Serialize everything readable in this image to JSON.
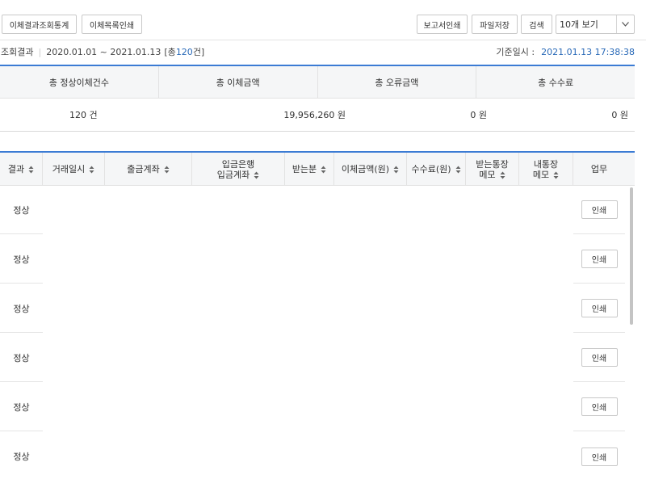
{
  "toolbar": {
    "transfer_stats_label": "이체결과조회통계",
    "list_print_label": "이체목록인쇄",
    "report_print_label": "보고서인쇄",
    "file_save_label": "파일저장",
    "search_label": "검색",
    "page_size_value": "10개 보기"
  },
  "info": {
    "result_label": "조회결과",
    "date_range": "2020.01.01 ~ 2021.01.13",
    "total_prefix": "[총",
    "total_count": "120",
    "total_suffix": "건]",
    "base_label": "기준일시 :",
    "base_datetime": "2021.01.13 17:38:38"
  },
  "summary": {
    "headers": [
      "총 정상이체건수",
      "총 이체금액",
      "총 오류금액",
      "총 수수료"
    ],
    "values": [
      "120 건",
      "19,956,260 원",
      "0 원",
      "0 원"
    ]
  },
  "list": {
    "headers": {
      "result": "결과",
      "date": "거래일시",
      "out_account": "출금계좌",
      "in_bank": "입금은행",
      "in_account": "입금계좌",
      "receiver": "받는분",
      "amount": "이체금액(원)",
      "fee": "수수료(원)",
      "recv_memo_1": "받는통장",
      "recv_memo_2": "메모",
      "my_memo_1": "내통장",
      "my_memo_2": "메모",
      "task": "업무"
    },
    "rows": [
      {
        "result": "정상",
        "action": "인쇄"
      },
      {
        "result": "정상",
        "action": "인쇄"
      },
      {
        "result": "정상",
        "action": "인쇄"
      },
      {
        "result": "정상",
        "action": "인쇄"
      },
      {
        "result": "정상",
        "action": "인쇄"
      },
      {
        "result": "정상",
        "action": "인쇄"
      }
    ]
  },
  "icons": {
    "sort": "sort-updown-icon",
    "dropdown": "chevron-down-icon"
  }
}
